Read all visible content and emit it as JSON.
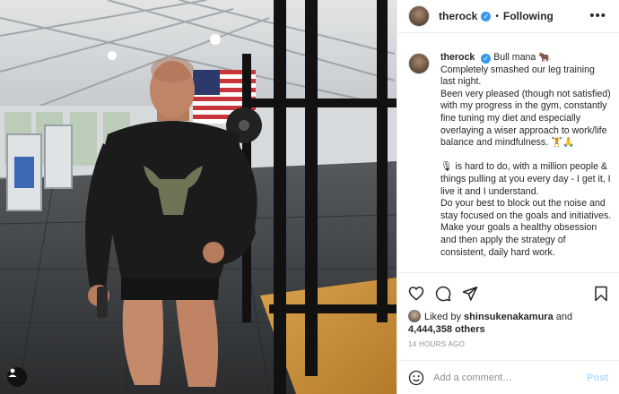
{
  "photo": {
    "alt": "",
    "tag_icon": "user-tag-icon"
  },
  "header": {
    "username": "therock",
    "verified_icon": "verified-badge-icon",
    "separator": "•",
    "follow_state": "Following",
    "more_icon": "more-options-icon"
  },
  "caption": {
    "username": "therock",
    "lines": [
      "Bull mana 🐂",
      "Completely smashed our leg training last night.",
      "Been very pleased (though not satisfied) with my progress in the gym, constantly fine tuning my diet and especially overlaying a wiser approach to work/life balance and mindfulness. 🏋🙏",
      "",
      "🎙 is hard to do, with a million people & things pulling at you every day - I get it, I live it and I understand.",
      "Do your best to block out the noise and stay focused on the goals and initiatives.",
      "Make your goals a healthy obsession and then apply the strategy of consistent, daily hard work."
    ]
  },
  "actions": {
    "like_icon": "heart-icon",
    "comment_icon": "comment-icon",
    "share_icon": "share-icon",
    "save_icon": "bookmark-icon"
  },
  "likes": {
    "prefix": "Liked by",
    "user": "shinsukenakamura",
    "conjunction": "and",
    "count": "4,444,358 others"
  },
  "timestamp": "14 hours ago",
  "comment": {
    "emoji_icon": "emoji-smile-icon",
    "placeholder": "Add a comment…",
    "post_label": "Post"
  },
  "colors": {
    "accent": "#3897f0",
    "post_disabled": "#b3dbff",
    "meta_gray": "#8e8e8e"
  }
}
